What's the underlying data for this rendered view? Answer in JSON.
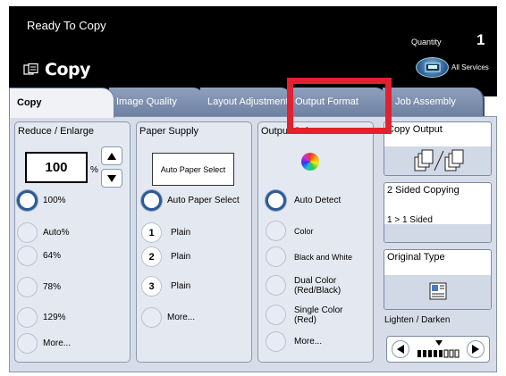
{
  "status": {
    "text": "Ready To Copy",
    "quantity_label": "Quantity",
    "quantity_value": "1"
  },
  "header": {
    "title": "Copy",
    "all_services_label": "All Services"
  },
  "tabs": [
    {
      "label": "Copy",
      "active": true
    },
    {
      "label": "Image Quality",
      "active": false
    },
    {
      "label": "Layout Adjustment",
      "active": false
    },
    {
      "label": "Output Format",
      "active": false
    },
    {
      "label": "Job Assembly",
      "active": false
    }
  ],
  "reduce_enlarge": {
    "title": "Reduce / Enlarge",
    "value": "100",
    "unit": "%",
    "options": [
      "100%",
      "Auto%",
      "64%",
      "78%",
      "129%",
      "More..."
    ],
    "selected": "100%"
  },
  "paper_supply": {
    "title": "Paper Supply",
    "auto_box": "Auto Paper Select",
    "auto_option": "Auto Paper Select",
    "trays": [
      {
        "num": "1",
        "label": "Plain"
      },
      {
        "num": "2",
        "label": "Plain"
      },
      {
        "num": "3",
        "label": "Plain"
      }
    ],
    "more": "More..."
  },
  "output_color": {
    "title": "Output Color",
    "options": [
      "Auto Detect",
      "Color",
      "Black and White",
      "Dual Color (Red/Black)",
      "Single Color (Red)",
      "More..."
    ],
    "selected": "Auto Detect"
  },
  "right": {
    "copy_output": {
      "title": "Copy Output"
    },
    "two_sided": {
      "title": "2 Sided Copying",
      "value": "1 > 1 Sided"
    },
    "original_type": {
      "title": "Original Type"
    },
    "lighten_darken": {
      "label": "Lighten / Darken",
      "level": 0.5
    }
  },
  "colors": {
    "header_bg": "#000000",
    "tab_bg": "#7f91b0",
    "selected_ring": "#2d5a93",
    "highlight": "#e32030"
  }
}
